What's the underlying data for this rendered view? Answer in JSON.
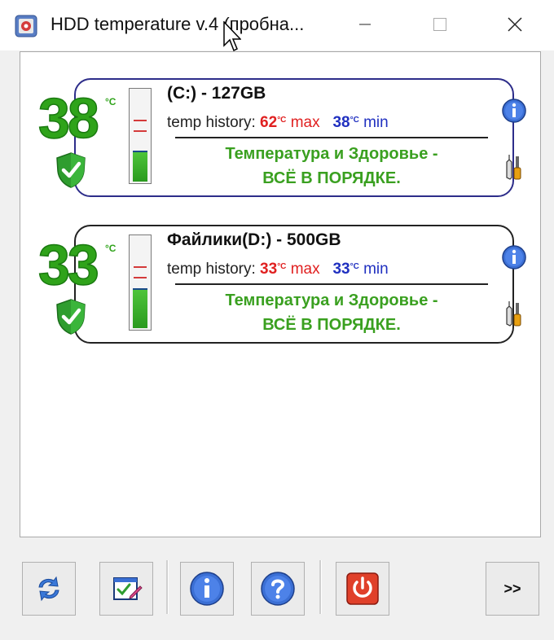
{
  "window": {
    "title": "HDD temperature v.4 (пробна..."
  },
  "disks": [
    {
      "temperature": "38",
      "unit": "°C",
      "name": "(C:) - 127GB",
      "history_label": "temp history:",
      "max_value": "62",
      "max_unit": "°C",
      "max_label": "max",
      "min_value": "38",
      "min_unit": "°C",
      "min_label": "min",
      "status_line1": "Температура и Здоровье -",
      "status_line2": "ВСЁ В ПОРЯДКЕ.",
      "gauge_level": 0.32
    },
    {
      "temperature": "33",
      "unit": "°C",
      "name": "Файлики(D:) - 500GB",
      "history_label": "temp history:",
      "max_value": "33",
      "max_unit": "°C",
      "max_label": "max",
      "min_value": "33",
      "min_unit": "°C",
      "min_label": "min",
      "status_line1": "Температура и Здоровье -",
      "status_line2": "ВСЁ В ПОРЯДКЕ.",
      "gauge_level": 0.42
    }
  ],
  "toolbar": {
    "more_label": ">>"
  },
  "colors": {
    "temp_green": "#2fa31a",
    "status_green": "#3aa020",
    "max_red": "#e02020",
    "min_blue": "#2030c0",
    "card_border_blue": "#2d2d8a"
  },
  "icons": [
    "refresh-icon",
    "settings-edit-icon",
    "info-icon",
    "help-icon",
    "power-icon",
    "tools-icon",
    "shield-check-icon"
  ]
}
